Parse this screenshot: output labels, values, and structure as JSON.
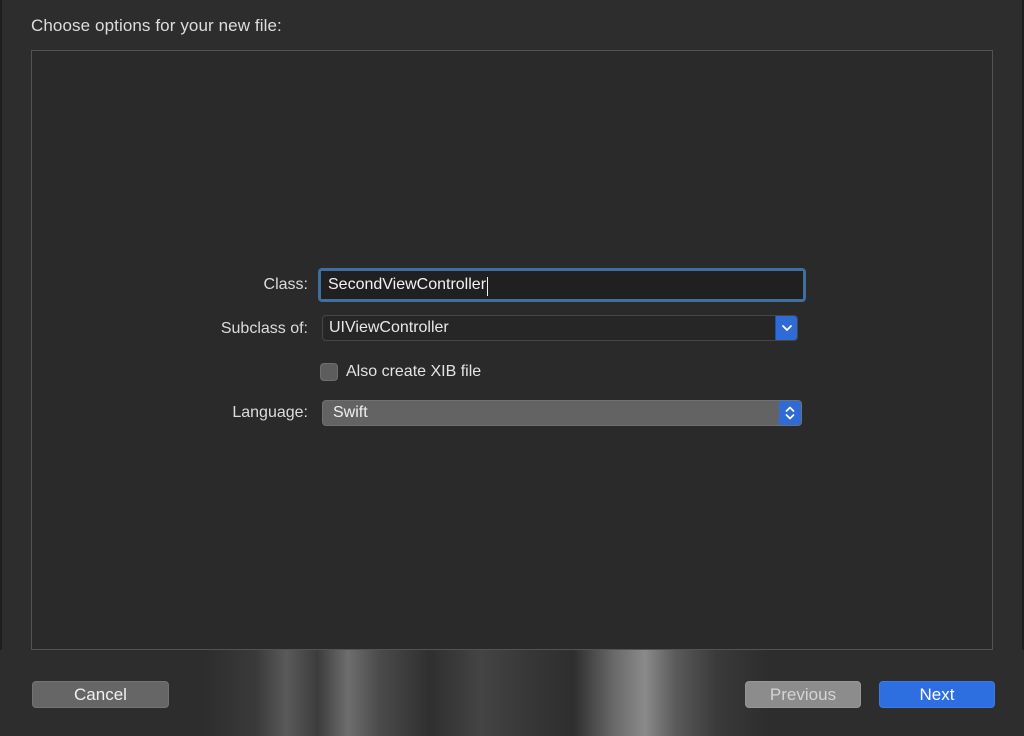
{
  "dialog": {
    "title": "Choose options for your new file:"
  },
  "form": {
    "class": {
      "label": "Class:",
      "value": "SecondViewController"
    },
    "subclass": {
      "label": "Subclass of:",
      "value": "UIViewController",
      "icon": "chevron-down-icon"
    },
    "xib": {
      "label": "Also create XIB file",
      "checked": false
    },
    "language": {
      "label": "Language:",
      "value": "Swift",
      "icon": "up-down-chevron-icon"
    }
  },
  "buttons": {
    "cancel": "Cancel",
    "previous": "Previous",
    "next": "Next"
  },
  "colors": {
    "accent": "#2d6fe0",
    "focus_ring": "#3f6f9e",
    "background": "#2d2d2d"
  }
}
